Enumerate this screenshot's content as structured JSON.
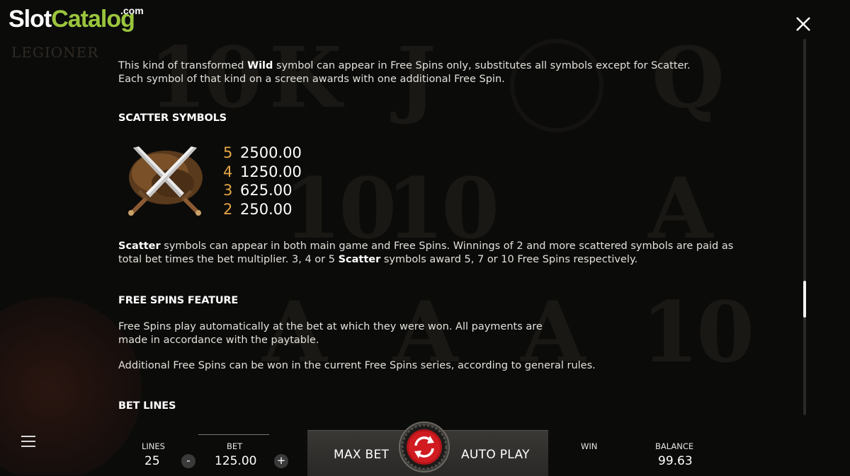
{
  "watermark": {
    "slot": "Slot",
    "catalog": "Catalog",
    "com": ".com",
    "game_logo": "LEGIONER"
  },
  "icons": {
    "close": "close-icon",
    "menu": "hamburger-menu-icon",
    "spin": "spin-arrows-icon",
    "scatter": "crossed-swords-scatter-icon"
  },
  "intro": {
    "line1_pre": "This kind of transformed ",
    "line1_bold": "Wild",
    "line1_post": " symbol can appear in Free Spins only, substitutes all symbols except for Scatter.",
    "line2": "Each symbol of that kind on a screen awards with one additional Free Spin."
  },
  "scatter": {
    "heading": "SCATTER SYMBOLS",
    "paytable": [
      {
        "count": "5",
        "value": "2500.00"
      },
      {
        "count": "4",
        "value": "1250.00"
      },
      {
        "count": "3",
        "value": "625.00"
      },
      {
        "count": "2",
        "value": "250.00"
      }
    ],
    "desc_bold1": "Scatter",
    "desc_part1": " symbols can appear in both main game and Free Spins. Winnings of 2 and more scattered symbols are paid as",
    "desc_part2": "total bet times the bet multiplier. 3, 4 or 5 ",
    "desc_bold2": "Scatter",
    "desc_part3": " symbols award 5, 7 or 10 Free Spins respectively."
  },
  "free_spins": {
    "heading": "FREE SPINS FEATURE",
    "para1_line1": "Free Spins play automatically at the bet at which they were won. All payments are",
    "para1_line2": "made in accordance with the paytable.",
    "para2": "Additional Free Spins can be won in the current Free Spins series, according to general rules."
  },
  "bet_lines": {
    "heading": "BET LINES"
  },
  "bottom_bar": {
    "lines_label": "LINES",
    "lines_value": "25",
    "bet_label": "BET",
    "bet_value": "125.00",
    "minus": "-",
    "plus": "+",
    "max_bet": "MAX BET",
    "auto_play": "AUTO PLAY",
    "win_label": "WIN",
    "win_value": "",
    "balance_label": "BALANCE",
    "balance_value": "99.63"
  },
  "colors": {
    "accent_orange": "#e4a646",
    "logo_green": "#9bc53d",
    "spin_red": "#c0181b"
  }
}
